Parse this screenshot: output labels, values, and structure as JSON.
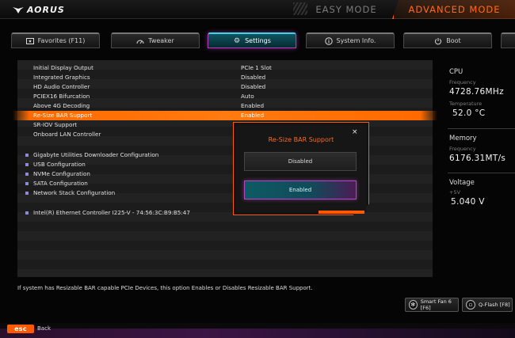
{
  "header": {
    "brand": "AORUS",
    "easy_mode": "EASY MODE",
    "advanced_mode": "ADVANCED MODE"
  },
  "tabs": [
    {
      "label": "Favorites (F11)",
      "icon": "star-folder-icon"
    },
    {
      "label": "Tweaker",
      "icon": "speedometer-icon"
    },
    {
      "label": "Settings",
      "icon": "gear-icon"
    },
    {
      "label": "System Info.",
      "icon": "info-icon"
    },
    {
      "label": "Boot",
      "icon": "power-icon"
    }
  ],
  "settings": [
    {
      "label": "Initial Display Output",
      "value": "PCIe 1 Slot"
    },
    {
      "label": "Integrated Graphics",
      "value": "Disabled"
    },
    {
      "label": "HD Audio Controller",
      "value": "Disabled"
    },
    {
      "label": "PCIEX16 Bifurcation",
      "value": "Auto"
    },
    {
      "label": "Above 4G Decoding",
      "value": "Enabled"
    },
    {
      "label": "Re-Size BAR Support",
      "value": "Enabled",
      "selected": true
    },
    {
      "label": "SR-IOV Support",
      "value": ""
    },
    {
      "label": "Onboard LAN Controller",
      "value": ""
    }
  ],
  "submenus": [
    "Gigabyte Utilities Downloader Configuration",
    "USB Configuration",
    "NVMe Configuration",
    "SATA Configuration",
    "Network Stack Configuration"
  ],
  "device": "Intel(R) Ethernet Controller I225-V - 74:56:3C:B9:B5:47",
  "help_text": "If system has Resizable BAR capable PCIe Devices, this option Enables or Disables Resizable BAR Support.",
  "sidebar": {
    "cpu": {
      "title": "CPU",
      "freq_label": "Frequency",
      "freq": "4728.76MHz",
      "temp_label": "Temperature",
      "temp": "52.0 °C"
    },
    "memory": {
      "title": "Memory",
      "freq_label": "Frequency",
      "freq": "6176.31MT/s"
    },
    "voltage": {
      "title": "Voltage",
      "rail_label": "+5V",
      "rail": "5.040 V"
    }
  },
  "dialog": {
    "title": "Re-Size BAR Support",
    "close": "×",
    "options": [
      "Disabled",
      "Enabled"
    ],
    "selected": "Enabled"
  },
  "bottom_buttons": {
    "smart_fan": "Smart Fan 6 [F6]",
    "qflash": "Q-Flash [F8]"
  },
  "footer": {
    "esc_key": "esc",
    "esc_label": "Back"
  },
  "colors": {
    "accent": "#ff6a00",
    "teal": "#0f5560",
    "magenta": "#b03fb8"
  }
}
